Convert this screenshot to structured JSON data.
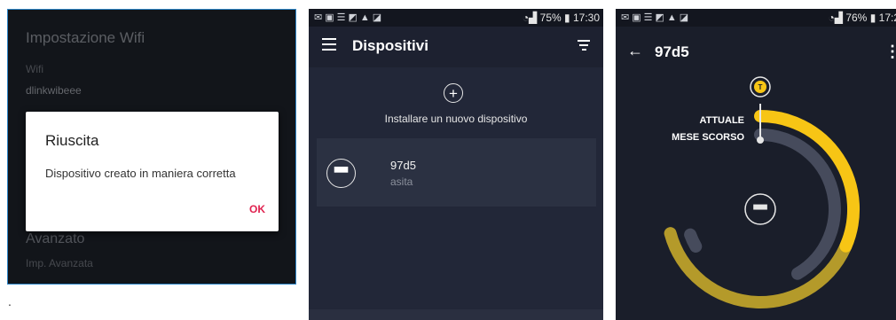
{
  "wifi_screen": {
    "title": "Impostazione Wifi",
    "wifi_label": "Wifi",
    "wifi_value": "dlinkwibeee",
    "advanced_title": "Avanzato",
    "advanced_sub": "Imp. Avanzata",
    "dialog": {
      "title": "Riuscita",
      "message": "Dispositivo creato in maniera corretta",
      "ok_label": "OK"
    },
    "caption": "."
  },
  "devices_screen": {
    "status": {
      "battery": "75%",
      "time": "17:30"
    },
    "title": "Dispositivi",
    "install_label": "Installare un nuovo dispositivo",
    "devices": [
      {
        "name": "97d5",
        "subtitle": "asita"
      }
    ]
  },
  "detail_screen": {
    "status": {
      "battery": "76%",
      "time": "17:2"
    },
    "title": "97d5",
    "current_label": "ATTUALE",
    "previous_label": "MESE SCORSO",
    "gauge": {
      "current_fraction": 0.42,
      "previous_fraction": 0.8
    },
    "colors": {
      "current": "#f7c515",
      "previous_fill": "#b49a2a",
      "track": "#464b5c"
    }
  }
}
